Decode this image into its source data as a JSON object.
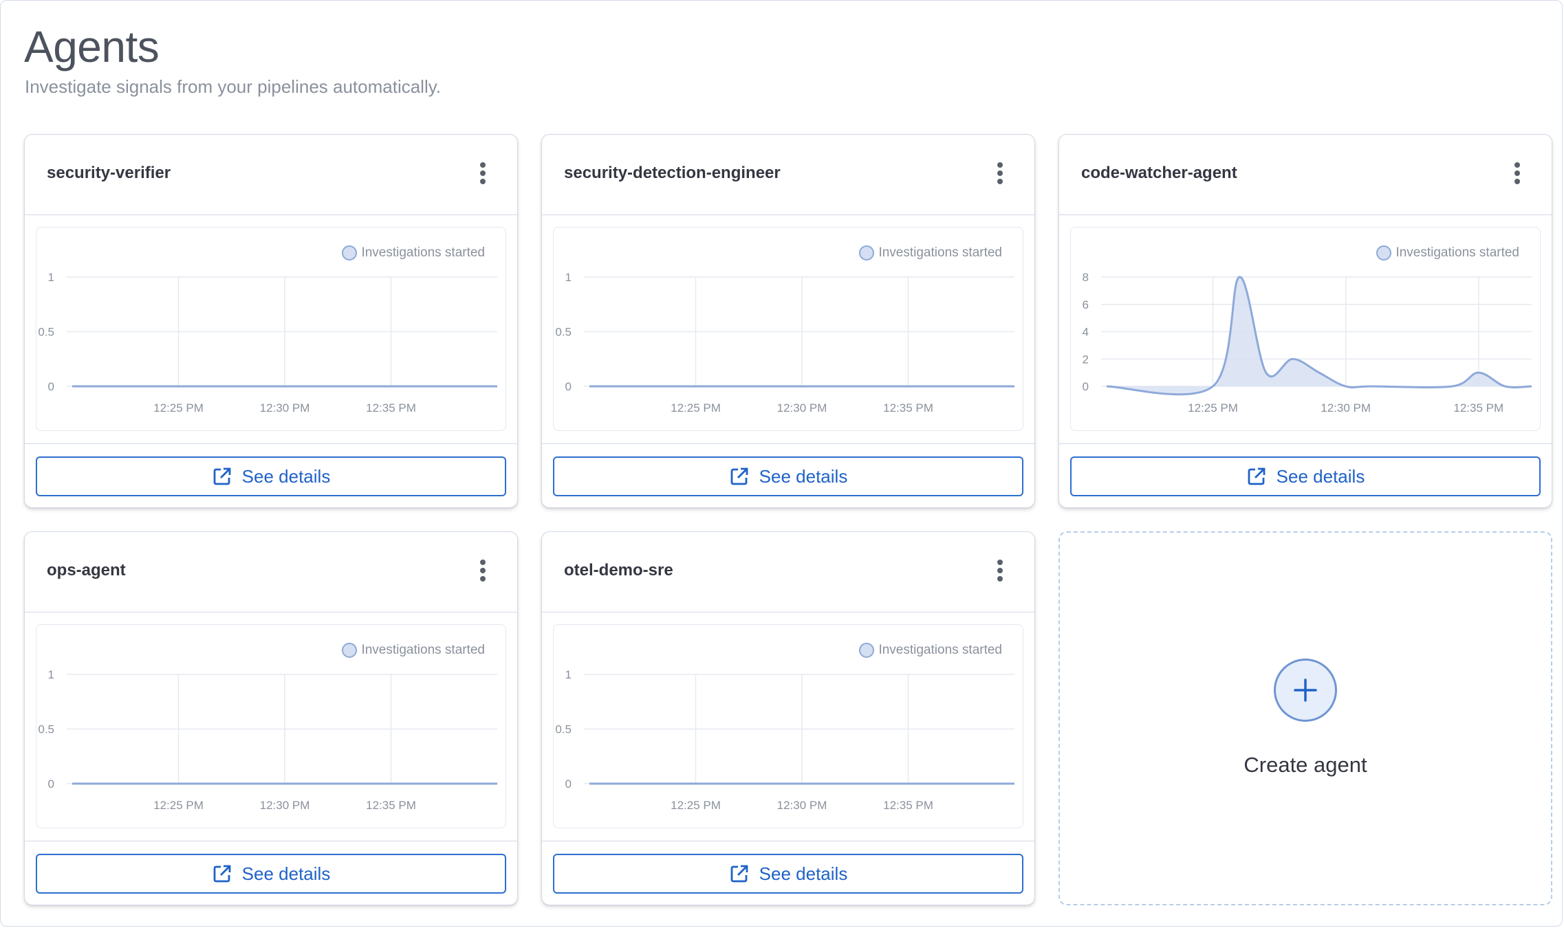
{
  "page": {
    "title": "Agents",
    "subtitle": "Investigate signals from your pipelines automatically."
  },
  "colors": {
    "accent": "#1f62c8",
    "series_line": "#8ea9d9",
    "series_fill": "#d4dff2"
  },
  "agents": [
    {
      "name": "security-verifier",
      "menu_icon": "kebab-menu-icon",
      "legend_label": "Investigations started",
      "button_label": "See details",
      "button_icon": "external-link-icon",
      "chart_data": {
        "type": "area",
        "x": [
          "12:20 PM",
          "12:25 PM",
          "12:30 PM",
          "12:35 PM",
          "12:40 PM"
        ],
        "xticks": [
          "12:25 PM",
          "12:30 PM",
          "12:35 PM"
        ],
        "yticks": [
          "0",
          "0.5",
          "1"
        ],
        "ylim": [
          0,
          1
        ],
        "series": [
          {
            "name": "Investigations started",
            "values": [
              0,
              0,
              0,
              0,
              0
            ]
          }
        ],
        "grid": true,
        "legend": "top-right"
      }
    },
    {
      "name": "security-detection-engineer",
      "menu_icon": "kebab-menu-icon",
      "legend_label": "Investigations started",
      "button_label": "See details",
      "button_icon": "external-link-icon",
      "chart_data": {
        "type": "area",
        "x": [
          "12:20 PM",
          "12:25 PM",
          "12:30 PM",
          "12:35 PM",
          "12:40 PM"
        ],
        "xticks": [
          "12:25 PM",
          "12:30 PM",
          "12:35 PM"
        ],
        "yticks": [
          "0",
          "0.5",
          "1"
        ],
        "ylim": [
          0,
          1
        ],
        "series": [
          {
            "name": "Investigations started",
            "values": [
              0,
              0,
              0,
              0,
              0
            ]
          }
        ],
        "grid": true,
        "legend": "top-right"
      }
    },
    {
      "name": "code-watcher-agent",
      "menu_icon": "kebab-menu-icon",
      "legend_label": "Investigations started",
      "button_label": "See details",
      "button_icon": "external-link-icon",
      "chart_data": {
        "type": "area",
        "x": [
          "12:21 PM",
          "12:25 PM",
          "12:26 PM",
          "12:27 PM",
          "12:28 PM",
          "12:29 PM",
          "12:30 PM",
          "12:31 PM",
          "12:34 PM",
          "12:35 PM",
          "12:36 PM",
          "12:37 PM"
        ],
        "xticks": [
          "12:25 PM",
          "12:30 PM",
          "12:35 PM"
        ],
        "yticks": [
          "0",
          "2",
          "4",
          "6",
          "8"
        ],
        "ylim": [
          0,
          8
        ],
        "series": [
          {
            "name": "Investigations started",
            "values": [
              0,
              0,
              8,
              1,
              2,
              1,
              0,
              0,
              0,
              1,
              0,
              0
            ]
          }
        ],
        "grid": true,
        "legend": "top-right"
      }
    },
    {
      "name": "ops-agent",
      "menu_icon": "kebab-menu-icon",
      "legend_label": "Investigations started",
      "button_label": "See details",
      "button_icon": "external-link-icon",
      "chart_data": {
        "type": "area",
        "x": [
          "12:20 PM",
          "12:25 PM",
          "12:30 PM",
          "12:35 PM",
          "12:40 PM"
        ],
        "xticks": [
          "12:25 PM",
          "12:30 PM",
          "12:35 PM"
        ],
        "yticks": [
          "0",
          "0.5",
          "1"
        ],
        "ylim": [
          0,
          1
        ],
        "series": [
          {
            "name": "Investigations started",
            "values": [
              0,
              0,
              0,
              0,
              0
            ]
          }
        ],
        "grid": true,
        "legend": "top-right"
      }
    },
    {
      "name": "otel-demo-sre",
      "menu_icon": "kebab-menu-icon",
      "legend_label": "Investigations started",
      "button_label": "See details",
      "button_icon": "external-link-icon",
      "chart_data": {
        "type": "area",
        "x": [
          "12:20 PM",
          "12:25 PM",
          "12:30 PM",
          "12:35 PM",
          "12:40 PM"
        ],
        "xticks": [
          "12:25 PM",
          "12:30 PM",
          "12:35 PM"
        ],
        "yticks": [
          "0",
          "0.5",
          "1"
        ],
        "ylim": [
          0,
          1
        ],
        "series": [
          {
            "name": "Investigations started",
            "values": [
              0,
              0,
              0,
              0,
              0
            ]
          }
        ],
        "grid": true,
        "legend": "top-right"
      }
    }
  ],
  "create_agent": {
    "label": "Create agent",
    "icon": "plus-icon"
  }
}
